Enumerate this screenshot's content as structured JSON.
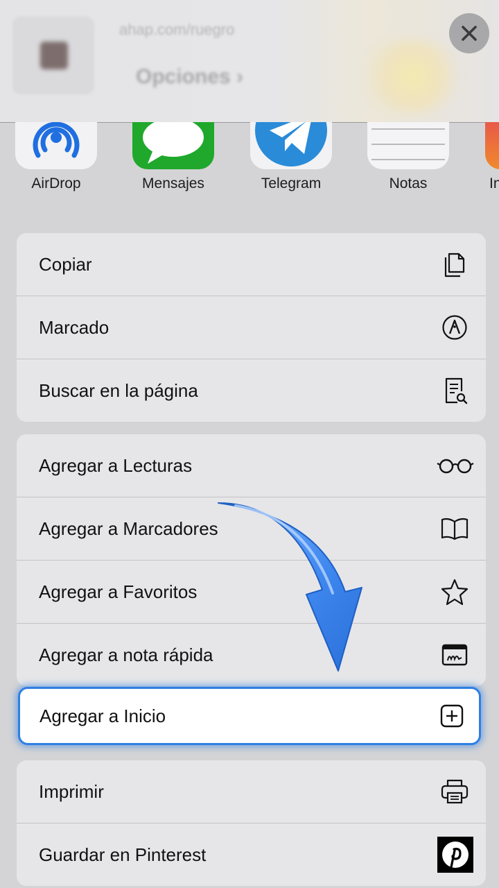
{
  "header": {
    "url_text": "ahap.com/ruegro",
    "options_label": "Opciones ›"
  },
  "share_apps": [
    {
      "label": "AirDrop",
      "icon": "airdrop-icon"
    },
    {
      "label": "Mensajes",
      "icon": "messages-icon"
    },
    {
      "label": "Telegram",
      "icon": "telegram-icon"
    },
    {
      "label": "Notas",
      "icon": "notes-icon"
    },
    {
      "label": "In",
      "icon": "instagram-icon"
    }
  ],
  "groups": [
    {
      "items": [
        {
          "label": "Copiar",
          "icon": "copy-icon"
        },
        {
          "label": "Marcado",
          "icon": "markup-icon"
        },
        {
          "label": "Buscar en la página",
          "icon": "find-on-page-icon"
        }
      ]
    },
    {
      "items": [
        {
          "label": "Agregar a Lecturas",
          "icon": "glasses-icon"
        },
        {
          "label": "Agregar a Marcadores",
          "icon": "book-icon"
        },
        {
          "label": "Agregar a Favoritos",
          "icon": "star-icon"
        },
        {
          "label": "Agregar a nota rápida",
          "icon": "quick-note-icon"
        }
      ]
    },
    {
      "items": [
        {
          "label": "Imprimir",
          "icon": "printer-icon"
        },
        {
          "label": "Guardar en Pinterest",
          "icon": "pinterest-icon"
        }
      ]
    }
  ],
  "highlighted_item": {
    "label": "Agregar a Inicio",
    "icon": "plus-square-icon"
  },
  "colors": {
    "highlight_border": "#2f7fe3",
    "arrow": "#4a8ff0",
    "messages_green": "#1fa82c",
    "airdrop_blue": "#1f6fe0",
    "telegram_blue": "#2a8bd8"
  }
}
